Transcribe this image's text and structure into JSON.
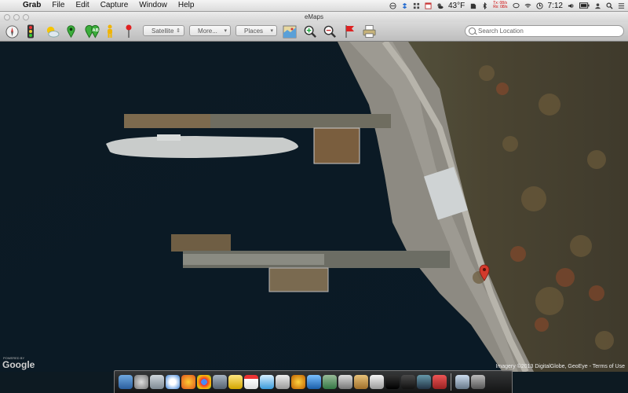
{
  "menubar": {
    "app_name": "Grab",
    "menus": [
      "File",
      "Edit",
      "Capture",
      "Window",
      "Help"
    ],
    "weather": "43°F",
    "time": "7:12",
    "net_tx": "Tx: 08/s",
    "net_rx": "Rx: 08/s"
  },
  "window": {
    "title": "eMaps"
  },
  "toolbar": {
    "map_type": "Satellite",
    "more_label": "More...",
    "places_label": "Places",
    "search_placeholder": "Search Location"
  },
  "map": {
    "attribution": "Imagery ©2013 DigitalGlobe, GeoEye - Terms of Use",
    "logo_caption": "POWERED BY",
    "logo_text": "Google"
  },
  "colors": {
    "water": "#0b1820",
    "land": "#4a4a38",
    "marker": "#d33a2c"
  }
}
